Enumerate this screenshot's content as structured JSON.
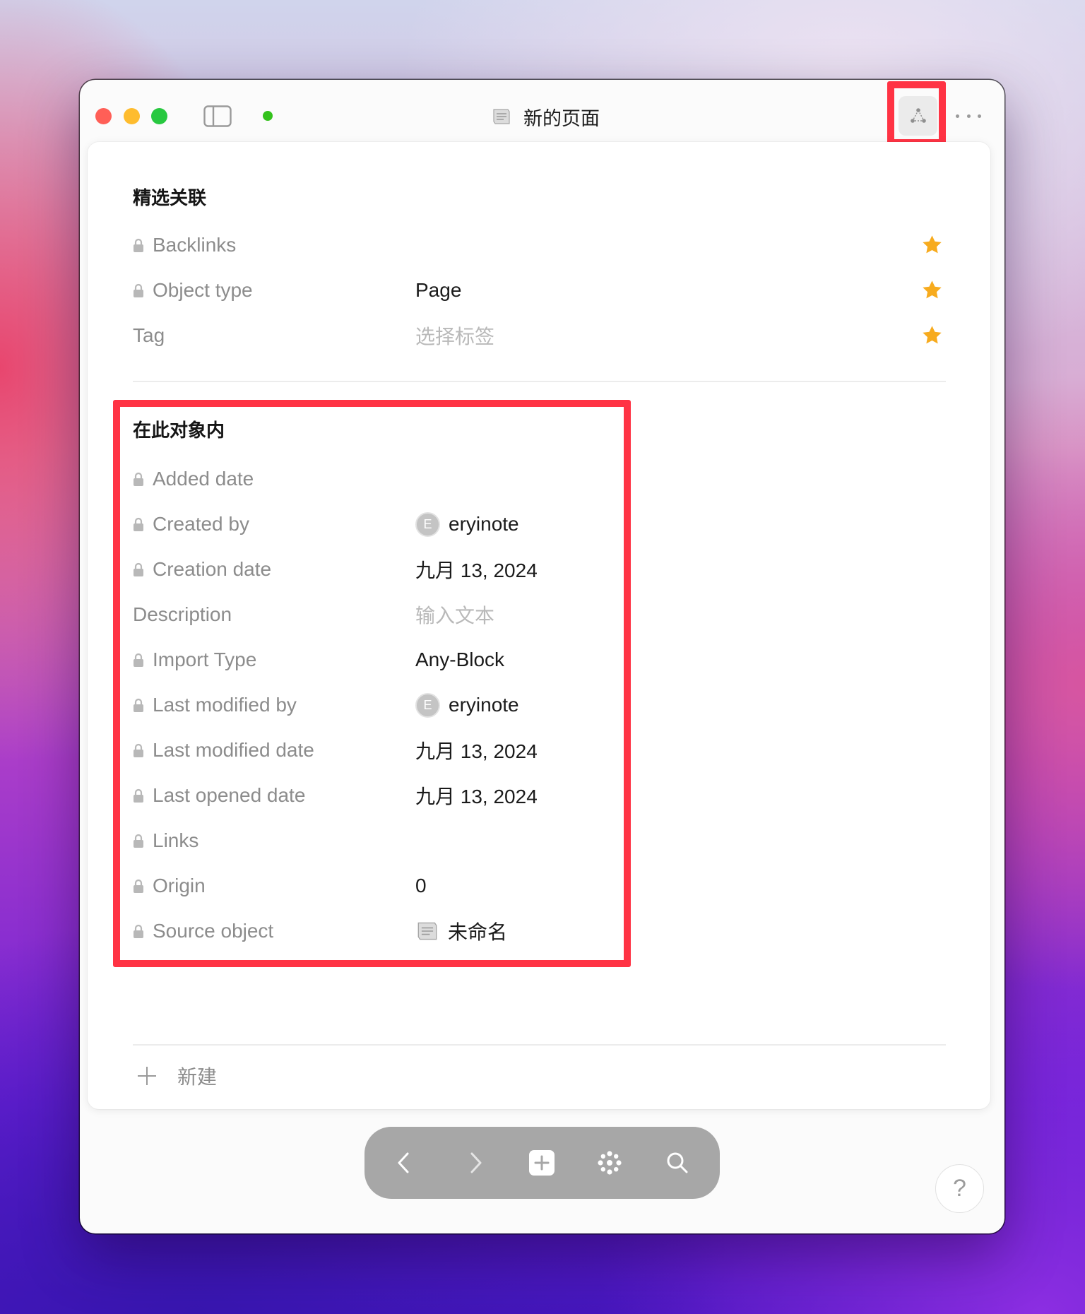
{
  "window": {
    "title": "新的页面",
    "title_icon": "page-icon"
  },
  "featured": {
    "title": "精选关联",
    "rows": [
      {
        "label": "Backlinks",
        "locked": true,
        "featured": true
      },
      {
        "label": "Object type",
        "locked": true,
        "featured": true,
        "value": "Page"
      },
      {
        "label": "Tag",
        "locked": false,
        "featured": true,
        "placeholder": "选择标签"
      }
    ]
  },
  "in_object": {
    "title": "在此对象内",
    "rows": [
      {
        "label": "Added date",
        "locked": true
      },
      {
        "label": "Created by",
        "locked": true,
        "avatar": "E",
        "value": "eryinote"
      },
      {
        "label": "Creation date",
        "locked": true,
        "value": "九月 13, 2024"
      },
      {
        "label": "Description",
        "locked": false,
        "placeholder": "输入文本"
      },
      {
        "label": "Import Type",
        "locked": true,
        "value": "Any-Block"
      },
      {
        "label": "Last modified by",
        "locked": true,
        "avatar": "E",
        "value": "eryinote"
      },
      {
        "label": "Last modified date",
        "locked": true,
        "value": "九月 13, 2024"
      },
      {
        "label": "Last opened date",
        "locked": true,
        "value": "九月 13, 2024"
      },
      {
        "label": "Links",
        "locked": true
      },
      {
        "label": "Origin",
        "locked": true,
        "value": "0"
      },
      {
        "label": "Source object",
        "locked": true,
        "icon": "page-icon",
        "value": "未命名"
      }
    ]
  },
  "footer": {
    "new_label": "新建"
  },
  "help": {
    "label": "?"
  },
  "colors": {
    "highlight": "#ff3344",
    "star": "#f7ab1e",
    "traffic_close": "#ff5f57",
    "traffic_minimize": "#febc2e",
    "traffic_zoom": "#28c840",
    "sync_status": "#34c21c"
  }
}
